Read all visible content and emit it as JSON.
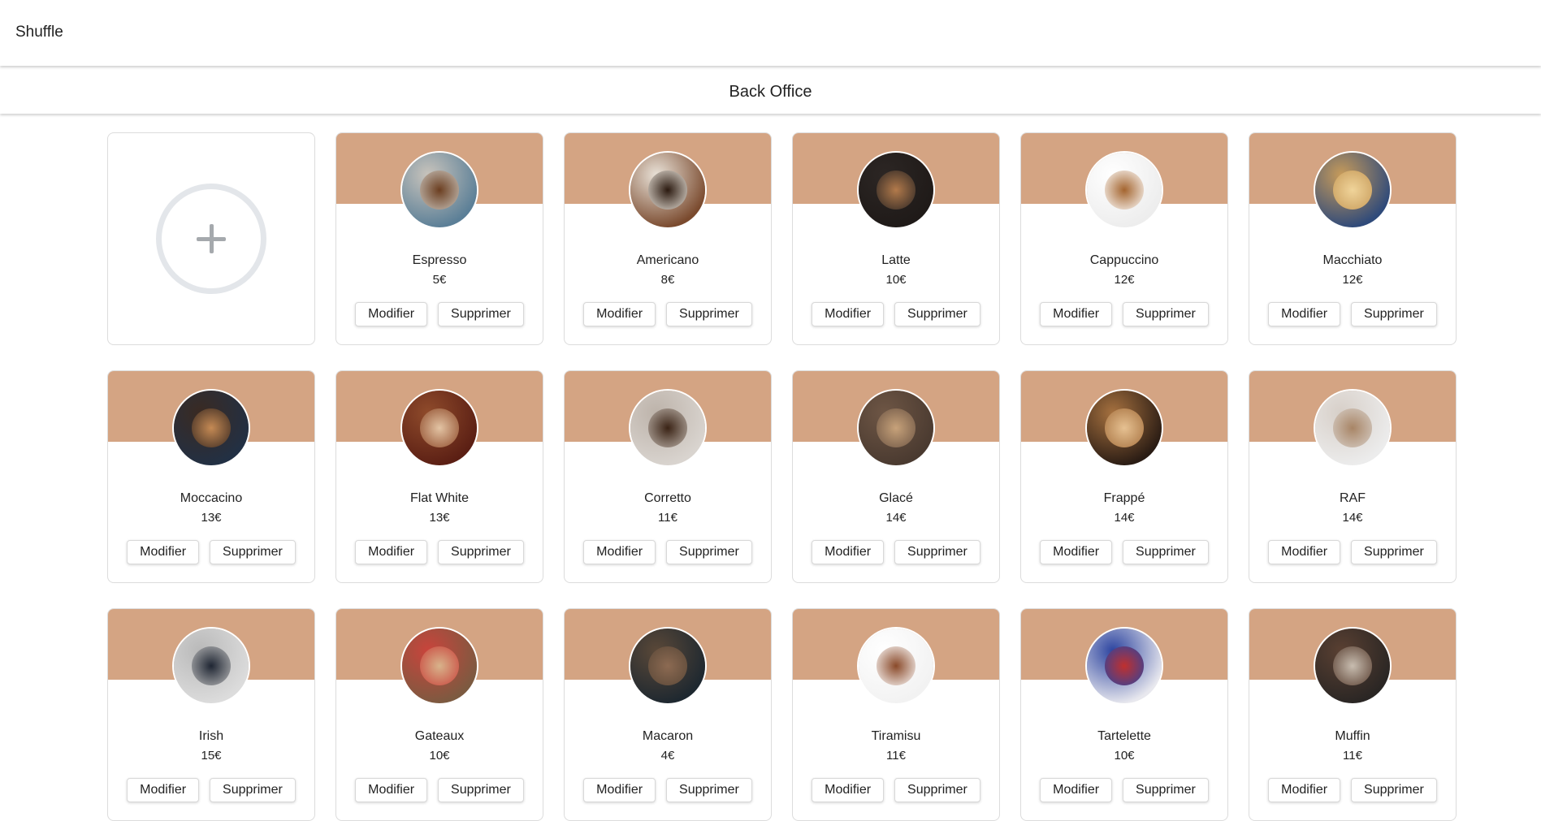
{
  "app": {
    "brand": "Shuffle",
    "section_title": "Back Office"
  },
  "actions": {
    "edit_label": "Modifier",
    "delete_label": "Supprimer"
  },
  "products": [
    {
      "name": "Espresso",
      "price": "5€",
      "icon": "espresso-photo",
      "colors": [
        "#5b7f97",
        "#c9c4bc",
        "#6b3e20"
      ]
    },
    {
      "name": "Americano",
      "price": "8€",
      "icon": "americano-photo",
      "colors": [
        "#7a4a2e",
        "#e9e2d8",
        "#2b1a10"
      ]
    },
    {
      "name": "Latte",
      "price": "10€",
      "icon": "latte-photo",
      "colors": [
        "#1f1a18",
        "#2c2624",
        "#b27a4b"
      ]
    },
    {
      "name": "Cappuccino",
      "price": "12€",
      "icon": "cappuccino-photo",
      "colors": [
        "#ededed",
        "#ffffff",
        "#a4652f"
      ]
    },
    {
      "name": "Macchiato",
      "price": "12€",
      "icon": "macchiato-photo",
      "colors": [
        "#2f4a7a",
        "#c79b5a",
        "#f0d49a"
      ]
    },
    {
      "name": "Moccacino",
      "price": "13€",
      "icon": "moccacino-photo",
      "colors": [
        "#223044",
        "#3a2a22",
        "#c58a54"
      ]
    },
    {
      "name": "Flat White",
      "price": "13€",
      "icon": "flat-white-photo",
      "colors": [
        "#5b1f14",
        "#8f4b2b",
        "#e3c4a4"
      ]
    },
    {
      "name": "Corretto",
      "price": "11€",
      "icon": "corretto-photo",
      "colors": [
        "#d9d4cf",
        "#bdb3aa",
        "#3a2315"
      ]
    },
    {
      "name": "Glacé",
      "price": "14€",
      "icon": "glace-photo",
      "colors": [
        "#4a3a30",
        "#6e5645",
        "#c7a27a"
      ]
    },
    {
      "name": "Frappé",
      "price": "14€",
      "icon": "frappe-photo",
      "colors": [
        "#2a1c14",
        "#a6713f",
        "#e6c192"
      ]
    },
    {
      "name": "RAF",
      "price": "14€",
      "icon": "raf-photo",
      "colors": [
        "#ececec",
        "#d7cfc8",
        "#a88566"
      ]
    },
    {
      "name": "Irish",
      "price": "15€",
      "icon": "irish-photo",
      "colors": [
        "#dcdcdc",
        "#b9b9b9",
        "#1f2633"
      ]
    },
    {
      "name": "Gateaux",
      "price": "10€",
      "icon": "gateaux-photo",
      "colors": [
        "#7c5a40",
        "#c9443c",
        "#d8b38b"
      ]
    },
    {
      "name": "Macaron",
      "price": "4€",
      "icon": "macaron-photo",
      "colors": [
        "#1e2830",
        "#5a4838",
        "#8c6a52"
      ]
    },
    {
      "name": "Tiramisu",
      "price": "11€",
      "icon": "tiramisu-photo",
      "colors": [
        "#f2f2f2",
        "#ffffff",
        "#8a4a2a"
      ]
    },
    {
      "name": "Tartelette",
      "price": "10€",
      "icon": "tartelette-photo",
      "colors": [
        "#e8e8ee",
        "#2c44a0",
        "#c0302e"
      ]
    },
    {
      "name": "Muffin",
      "price": "11€",
      "icon": "muffin-photo",
      "colors": [
        "#2a2624",
        "#5a4032",
        "#c8bdb0"
      ]
    }
  ],
  "colors": {
    "card_header": "#d4a483",
    "add_circle": "#e3e6ea",
    "add_plus": "#a5a9ad"
  },
  "add_card": {
    "icon": "plus-circle-icon"
  }
}
